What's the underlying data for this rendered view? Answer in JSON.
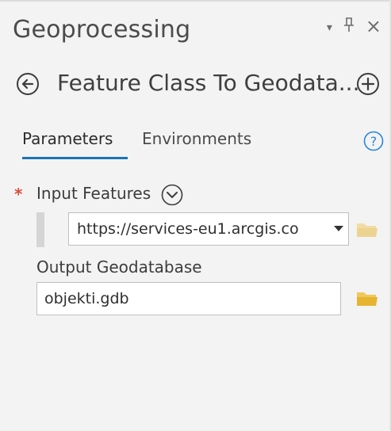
{
  "pane": {
    "title": "Geoprocessing",
    "controls": {
      "dropdown": "▾",
      "pin": "ᵖ",
      "close": "×"
    }
  },
  "tool": {
    "title": "Feature Class To Geodata...",
    "back_icon": "circle-arrow-left-icon",
    "add_icon": "circle-plus-icon"
  },
  "tabs": [
    {
      "label": "Parameters",
      "active": true
    },
    {
      "label": "Environments",
      "active": false
    }
  ],
  "help_icon": "question-circle-icon",
  "parameters": {
    "input_features": {
      "required_marker": "*",
      "label": "Input Features",
      "value": "https://services-eu1.arcgis.co"
    },
    "output_geodatabase": {
      "label": "Output Geodatabase",
      "value": "objekti.gdb"
    }
  },
  "colors": {
    "background": "#f3f3f3",
    "accent": "#1a73b5",
    "required": "#d94c3c",
    "folder": "#e6b430"
  }
}
